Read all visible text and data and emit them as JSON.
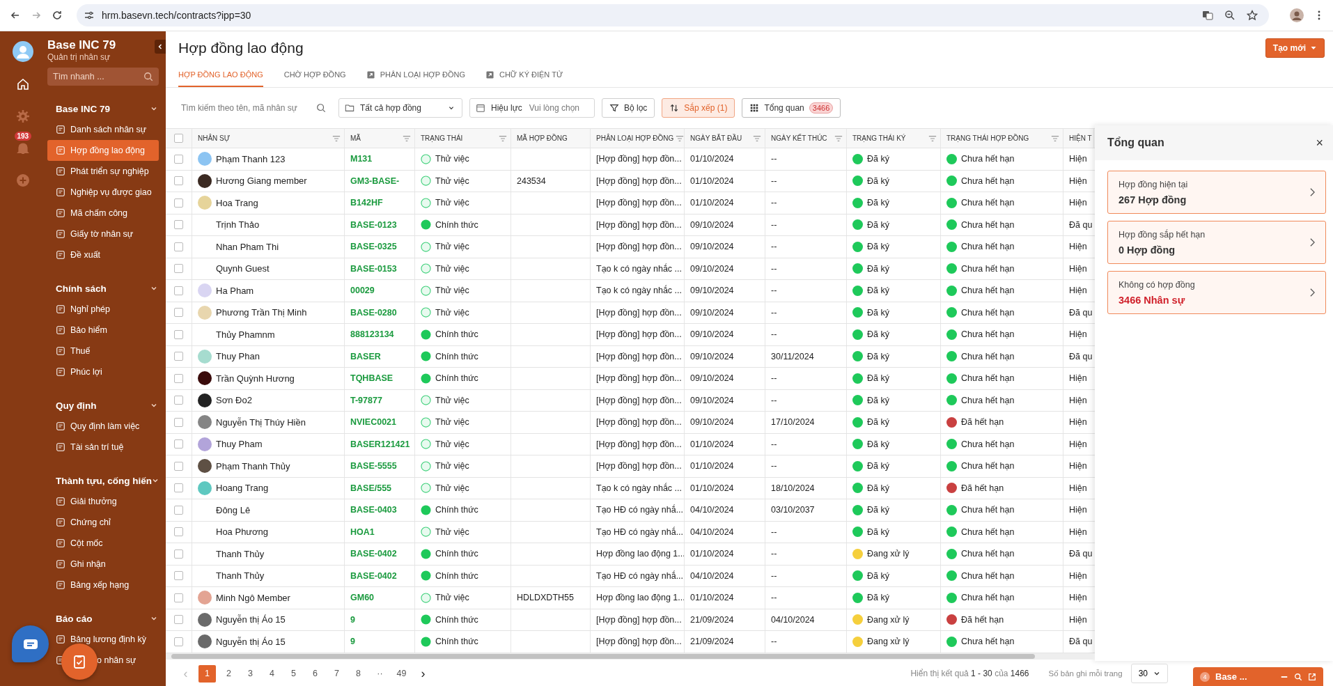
{
  "browser": {
    "url": "hrm.basevn.tech/contracts?ipp=30"
  },
  "rail": {
    "notifications": "193"
  },
  "sidebar": {
    "title": "Base INC 79",
    "subtitle": "Quản trị nhân sự",
    "search": {
      "placeholder": "Tìm nhanh ..."
    },
    "groups": [
      {
        "label": "Base INC 79",
        "expanded": true,
        "items": [
          {
            "label": "Danh sách nhân sự",
            "selected": false
          },
          {
            "label": "Hợp đồng lao động",
            "selected": true
          },
          {
            "label": "Phát triển sự nghiệp",
            "selected": false
          },
          {
            "label": "Nghiệp vụ được giao",
            "selected": false
          },
          {
            "label": "Mã chấm công",
            "selected": false
          },
          {
            "label": "Giấy tờ nhân sự",
            "selected": false
          },
          {
            "label": "Đề xuất",
            "selected": false
          }
        ]
      },
      {
        "label": "Chính sách",
        "expanded": true,
        "items": [
          {
            "label": "Nghỉ phép",
            "selected": false
          },
          {
            "label": "Bảo hiểm",
            "selected": false
          },
          {
            "label": "Thuế",
            "selected": false
          },
          {
            "label": "Phúc lợi",
            "selected": false
          }
        ]
      },
      {
        "label": "Quy định",
        "expanded": true,
        "items": [
          {
            "label": "Quy định làm việc",
            "selected": false
          },
          {
            "label": "Tài sản trí tuệ",
            "selected": false
          }
        ]
      },
      {
        "label": "Thành tựu, cống hiến",
        "expanded": true,
        "items": [
          {
            "label": "Giải thưởng",
            "selected": false
          },
          {
            "label": "Chứng chỉ",
            "selected": false
          },
          {
            "label": "Cột mốc",
            "selected": false
          },
          {
            "label": "Ghi nhận",
            "selected": false
          },
          {
            "label": "Bảng xếp hạng",
            "selected": false
          }
        ]
      },
      {
        "label": "Báo cáo",
        "expanded": true,
        "items": [
          {
            "label": "Bảng lương định kỳ",
            "selected": false
          },
          {
            "label": "o nhân sự",
            "selected": false
          }
        ]
      }
    ]
  },
  "page": {
    "title": "Hợp đồng lao động",
    "create_button": "Tạo mới",
    "tabs": [
      {
        "label": "HỢP ĐỒNG LAO ĐỘNG",
        "selected": true,
        "external": false
      },
      {
        "label": "CHỜ HỢP ĐỒNG",
        "selected": false,
        "external": false
      },
      {
        "label": "PHÂN LOẠI HỢP ĐỒNG",
        "selected": false,
        "external": true
      },
      {
        "label": "CHỮ KÝ ĐIỆN TỬ",
        "selected": false,
        "external": true
      }
    ]
  },
  "toolbar": {
    "search": {
      "placeholder": "Tìm kiếm theo tên, mã nhân sự"
    },
    "contract_filter": "Tất cả hợp đồng",
    "date": {
      "label": "Hiệu lực",
      "placeholder": "Vui lòng chọn"
    },
    "filter_button": "Bộ lọc",
    "sort_button": {
      "label": "Sắp xếp (1)",
      "active": true
    },
    "overview_button": {
      "label": "Tổng quan",
      "count": "3466",
      "selected": true
    }
  },
  "table": {
    "all_checked": false,
    "columns": [
      {
        "label": "NHÂN SỰ",
        "filter": true
      },
      {
        "label": "MÃ",
        "filter": true
      },
      {
        "label": "TRẠNG THÁI",
        "filter": true
      },
      {
        "label": "MÃ HỢP ĐỒNG",
        "filter": false
      },
      {
        "label": "PHÂN LOẠI HỢP ĐỒNG",
        "filter": true
      },
      {
        "label": "NGÀY BẮT ĐẦU",
        "filter": true
      },
      {
        "label": "NGÀY KẾT THÚC",
        "filter": true
      },
      {
        "label": "TRẠNG THÁI KÝ",
        "filter": true
      },
      {
        "label": "TRẠNG THÁI HỢP ĐỒNG",
        "filter": true
      },
      {
        "label": "HIỆN T",
        "filter": false
      }
    ],
    "rows": [
      {
        "checked": false,
        "name": "Phạm Thanh 123",
        "avatar": {
          "color": "#8cc4f2"
        },
        "code": "M131",
        "status": {
          "text": "Thử việc",
          "kind": "outline"
        },
        "contract_no": "",
        "type": "[Hợp đồng] hợp đồn...",
        "start": "01/10/2024",
        "end": "--",
        "sign": {
          "text": "Đã ký",
          "color": "#1ec95a"
        },
        "contract_status": {
          "text": "Chưa hết hạn",
          "color": "#1ec95a"
        },
        "current": "Hiện"
      },
      {
        "checked": false,
        "name": "Hương Giang member",
        "avatar": {
          "color": "#3b2a22"
        },
        "code": "GM3-BASE-",
        "status": {
          "text": "Thử việc",
          "kind": "outline"
        },
        "contract_no": "243534",
        "type": "[Hợp đồng] hợp đồn...",
        "start": "01/10/2024",
        "end": "--",
        "sign": {
          "text": "Đã ký",
          "color": "#1ec95a"
        },
        "contract_status": {
          "text": "Chưa hết hạn",
          "color": "#1ec95a"
        },
        "current": "Hiện"
      },
      {
        "checked": false,
        "name": "Hoa Trang",
        "avatar": {
          "color": "#e6d49a"
        },
        "code": "B142HF",
        "status": {
          "text": "Thử việc",
          "kind": "outline"
        },
        "contract_no": "",
        "type": "[Hợp đồng] hợp đồn...",
        "start": "01/10/2024",
        "end": "--",
        "sign": {
          "text": "Đã ký",
          "color": "#1ec95a"
        },
        "contract_status": {
          "text": "Chưa hết hạn",
          "color": "#1ec95a"
        },
        "current": "Hiện"
      },
      {
        "checked": false,
        "name": "Trịnh Thảo",
        "code": "BASE-0123",
        "status": {
          "text": "Chính thức",
          "kind": "filled"
        },
        "contract_no": "",
        "type": "[Hợp đồng] hợp đồn...",
        "start": "09/10/2024",
        "end": "--",
        "sign": {
          "text": "Đã ký",
          "color": "#1ec95a"
        },
        "contract_status": {
          "text": "Chưa hết hạn",
          "color": "#1ec95a"
        },
        "current": "Đã qu"
      },
      {
        "checked": false,
        "name": "Nhan Pham Thi",
        "code": "BASE-0325",
        "status": {
          "text": "Thử việc",
          "kind": "outline"
        },
        "contract_no": "",
        "type": "[Hợp đồng] hợp đồn...",
        "start": "09/10/2024",
        "end": "--",
        "sign": {
          "text": "Đã ký",
          "color": "#1ec95a"
        },
        "contract_status": {
          "text": "Chưa hết hạn",
          "color": "#1ec95a"
        },
        "current": "Hiện"
      },
      {
        "checked": false,
        "name": "Quynh Guest",
        "code": "BASE-0153",
        "status": {
          "text": "Thử việc",
          "kind": "outline"
        },
        "contract_no": "",
        "type": "Tạo k có ngày nhắc ...",
        "start": "09/10/2024",
        "end": "--",
        "sign": {
          "text": "Đã ký",
          "color": "#1ec95a"
        },
        "contract_status": {
          "text": "Chưa hết hạn",
          "color": "#1ec95a"
        },
        "current": "Hiện"
      },
      {
        "checked": false,
        "name": "Ha Pham",
        "avatar": {
          "color": "#d9d5f2"
        },
        "code": "00029",
        "status": {
          "text": "Thử việc",
          "kind": "outline"
        },
        "contract_no": "",
        "type": "Tạo k có ngày nhắc ...",
        "start": "09/10/2024",
        "end": "--",
        "sign": {
          "text": "Đã ký",
          "color": "#1ec95a"
        },
        "contract_status": {
          "text": "Chưa hết hạn",
          "color": "#1ec95a"
        },
        "current": "Hiện"
      },
      {
        "checked": false,
        "name": "Phương Trần Thị Minh",
        "avatar": {
          "color": "#e8d6ae"
        },
        "code": "BASE-0280",
        "status": {
          "text": "Thử việc",
          "kind": "outline"
        },
        "contract_no": "",
        "type": "[Hợp đồng] hợp đồn...",
        "start": "09/10/2024",
        "end": "--",
        "sign": {
          "text": "Đã ký",
          "color": "#1ec95a"
        },
        "contract_status": {
          "text": "Chưa hết hạn",
          "color": "#1ec95a"
        },
        "current": "Đã qu"
      },
      {
        "checked": false,
        "name": "Thủy Phamnm",
        "code": "888123134",
        "status": {
          "text": "Chính thức",
          "kind": "filled"
        },
        "contract_no": "",
        "type": "[Hợp đồng] hợp đồn...",
        "start": "09/10/2024",
        "end": "--",
        "sign": {
          "text": "Đã ký",
          "color": "#1ec95a"
        },
        "contract_status": {
          "text": "Chưa hết hạn",
          "color": "#1ec95a"
        },
        "current": "Hiện"
      },
      {
        "checked": false,
        "name": "Thuy Phan",
        "avatar": {
          "color": "#a6dccf"
        },
        "code": "BASER",
        "status": {
          "text": "Chính thức",
          "kind": "filled"
        },
        "contract_no": "",
        "type": "[Hợp đồng] hợp đồn...",
        "start": "09/10/2024",
        "end": "30/11/2024",
        "sign": {
          "text": "Đã ký",
          "color": "#1ec95a"
        },
        "contract_status": {
          "text": "Chưa hết hạn",
          "color": "#1ec95a"
        },
        "current": "Đã qu"
      },
      {
        "checked": false,
        "name": "Trần Quỳnh Hương",
        "avatar": {
          "color": "#3a0b0b"
        },
        "code": "TQHBASE",
        "status": {
          "text": "Chính thức",
          "kind": "filled"
        },
        "contract_no": "",
        "type": "[Hợp đồng] hợp đồn...",
        "start": "09/10/2024",
        "end": "--",
        "sign": {
          "text": "Đã ký",
          "color": "#1ec95a"
        },
        "contract_status": {
          "text": "Chưa hết hạn",
          "color": "#1ec95a"
        },
        "current": "Hiện"
      },
      {
        "checked": false,
        "name": "Sơn Đo2",
        "avatar": {
          "color": "#222222"
        },
        "code": "T-97877",
        "status": {
          "text": "Thử việc",
          "kind": "outline"
        },
        "contract_no": "",
        "type": "[Hợp đồng] hợp đồn...",
        "start": "09/10/2024",
        "end": "--",
        "sign": {
          "text": "Đã ký",
          "color": "#1ec95a"
        },
        "contract_status": {
          "text": "Chưa hết hạn",
          "color": "#1ec95a"
        },
        "current": "Hiện"
      },
      {
        "checked": false,
        "name": "Nguyễn Thị Thúy Hiền",
        "avatar": {
          "color": "#858585"
        },
        "code": "NVIEC0021",
        "status": {
          "text": "Thử việc",
          "kind": "outline"
        },
        "contract_no": "",
        "type": "[Hợp đồng] hợp đồn...",
        "start": "09/10/2024",
        "end": "17/10/2024",
        "sign": {
          "text": "Đã ký",
          "color": "#1ec95a"
        },
        "contract_status": {
          "text": "Đã hết hạn",
          "color": "#c94040"
        },
        "current": "Hiện"
      },
      {
        "checked": false,
        "name": "Thuy Pham",
        "avatar": {
          "color": "#b2a4da"
        },
        "code": "BASER121421",
        "status": {
          "text": "Thử việc",
          "kind": "outline"
        },
        "contract_no": "",
        "type": "[Hợp đồng] hợp đồn...",
        "start": "01/10/2024",
        "end": "--",
        "sign": {
          "text": "Đã ký",
          "color": "#1ec95a"
        },
        "contract_status": {
          "text": "Chưa hết hạn",
          "color": "#1ec95a"
        },
        "current": "Hiện"
      },
      {
        "checked": false,
        "name": "Phạm  Thanh Thủy",
        "avatar": {
          "color": "#5e5044"
        },
        "code": "BASE-5555",
        "status": {
          "text": "Thử việc",
          "kind": "outline"
        },
        "contract_no": "",
        "type": "[Hợp đồng] hợp đồn...",
        "start": "01/10/2024",
        "end": "--",
        "sign": {
          "text": "Đã ký",
          "color": "#1ec95a"
        },
        "contract_status": {
          "text": "Chưa hết hạn",
          "color": "#1ec95a"
        },
        "current": "Hiện"
      },
      {
        "checked": false,
        "name": "Hoang Trang",
        "avatar": {
          "color": "#5ec8c0"
        },
        "code": "BASE/555",
        "status": {
          "text": "Thử việc",
          "kind": "outline"
        },
        "contract_no": "",
        "type": "Tạo k có ngày nhắc ...",
        "start": "01/10/2024",
        "end": "18/10/2024",
        "sign": {
          "text": "Đã ký",
          "color": "#1ec95a"
        },
        "contract_status": {
          "text": "Đã hết hạn",
          "color": "#c94040"
        },
        "current": "Hiện"
      },
      {
        "checked": false,
        "name": "Đông Lê",
        "code": "BASE-0403",
        "status": {
          "text": "Chính thức",
          "kind": "filled"
        },
        "contract_no": "",
        "type": "Tạo HĐ có ngày nhắ...",
        "start": "04/10/2024",
        "end": "03/10/2037",
        "sign": {
          "text": "Đã ký",
          "color": "#1ec95a"
        },
        "contract_status": {
          "text": "Chưa hết hạn",
          "color": "#1ec95a"
        },
        "current": "Hiện"
      },
      {
        "checked": false,
        "name": "Hoa Phương",
        "code": "HOA1",
        "status": {
          "text": "Thử việc",
          "kind": "outline"
        },
        "contract_no": "",
        "type": "Tạo HĐ có ngày nhắ...",
        "start": "04/10/2024",
        "end": "--",
        "sign": {
          "text": "Đã ký",
          "color": "#1ec95a"
        },
        "contract_status": {
          "text": "Chưa hết hạn",
          "color": "#1ec95a"
        },
        "current": "Hiện"
      },
      {
        "checked": false,
        "name": "Thanh Thủy",
        "code": "BASE-0402",
        "status": {
          "text": "Chính thức",
          "kind": "filled"
        },
        "contract_no": "",
        "type": "Hợp đồng lao động 1...",
        "start": "01/10/2024",
        "end": "--",
        "sign": {
          "text": "Đang xử lý",
          "color": "#f5cf3c"
        },
        "contract_status": {
          "text": "Chưa hết hạn",
          "color": "#1ec95a"
        },
        "current": "Đã qu"
      },
      {
        "checked": false,
        "name": "Thanh Thủy",
        "code": "BASE-0402",
        "status": {
          "text": "Chính thức",
          "kind": "filled"
        },
        "contract_no": "",
        "type": "Tạo HĐ có ngày nhắ...",
        "start": "04/10/2024",
        "end": "--",
        "sign": {
          "text": "Đã ký",
          "color": "#1ec95a"
        },
        "contract_status": {
          "text": "Chưa hết hạn",
          "color": "#1ec95a"
        },
        "current": "Hiện"
      },
      {
        "checked": false,
        "name": "Minh Ngô Member",
        "avatar": {
          "color": "#e3a493"
        },
        "code": "GM60",
        "status": {
          "text": "Thử việc",
          "kind": "outline"
        },
        "contract_no": "HDLDXDTH55",
        "type": "Hợp đồng lao động 1...",
        "start": "01/10/2024",
        "end": "--",
        "sign": {
          "text": "Đã ký",
          "color": "#1ec95a"
        },
        "contract_status": {
          "text": "Chưa hết hạn",
          "color": "#1ec95a"
        },
        "current": "Hiện"
      },
      {
        "checked": false,
        "name": "Nguyễn thị Áo 15",
        "avatar": {
          "color": "#6a6a6a"
        },
        "code": "9",
        "status": {
          "text": "Chính thức",
          "kind": "filled"
        },
        "contract_no": "",
        "type": "[Hợp đồng] hợp đồn...",
        "start": "21/09/2024",
        "end": "04/10/2024",
        "sign": {
          "text": "Đang xử lý",
          "color": "#f5cf3c"
        },
        "contract_status": {
          "text": "Đã hết hạn",
          "color": "#c94040"
        },
        "current": "Hiện"
      },
      {
        "checked": false,
        "name": "Nguyễn thị Áo 15",
        "avatar": {
          "color": "#6a6a6a"
        },
        "code": "9",
        "status": {
          "text": "Chính thức",
          "kind": "filled"
        },
        "contract_no": "",
        "type": "[Hợp đồng] hợp đồn...",
        "start": "21/09/2024",
        "end": "--",
        "sign": {
          "text": "Đang xử lý",
          "color": "#f5cf3c"
        },
        "contract_status": {
          "text": "Chưa hết hạn",
          "color": "#1ec95a"
        },
        "current": "Đã qu"
      }
    ]
  },
  "pagination": {
    "prev": "‹",
    "next": "›",
    "pages": [
      {
        "label": "1",
        "selected": true
      },
      {
        "label": "2",
        "selected": false
      },
      {
        "label": "3",
        "selected": false
      },
      {
        "label": "4",
        "selected": false
      },
      {
        "label": "5",
        "selected": false
      },
      {
        "label": "6",
        "selected": false
      },
      {
        "label": "7",
        "selected": false
      },
      {
        "label": "8",
        "selected": false
      },
      {
        "label": "··",
        "selected": false
      },
      {
        "label": "49",
        "selected": false
      }
    ],
    "summary": "Hiển thị kết quả **1 - 30** của **1466**",
    "per_page_label": "Số bản ghi mỗi trang",
    "per_page": "30"
  },
  "overview": {
    "title": "Tổng quan",
    "close": "×",
    "cards": [
      {
        "label": "Hợp đồng hiện tại",
        "value": "267 Hợp đồng",
        "alert": false
      },
      {
        "label": "Hợp đồng sắp hết hạn",
        "value": "0 Hợp đồng",
        "alert": false
      },
      {
        "label": "Không có hợp đồng",
        "value": "3466 Nhân sự",
        "alert": true
      }
    ]
  },
  "chat_widget": {
    "count": "4",
    "title": "Base ..."
  }
}
